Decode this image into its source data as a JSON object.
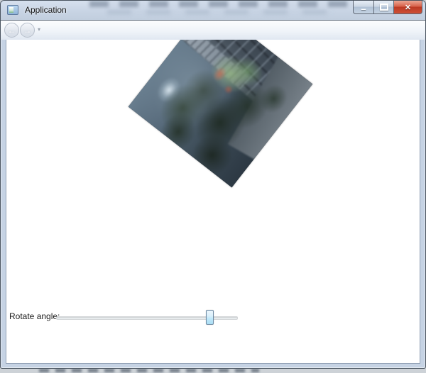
{
  "window": {
    "title": "Application",
    "controls": {
      "minimize_icon": "–",
      "maximize_icon": "maximize-box",
      "close_icon": "✕"
    }
  },
  "navbar": {
    "back_icon": "←",
    "forward_icon": "→",
    "dropdown_icon": "▾"
  },
  "content": {
    "image": {
      "name": "garden-courtyard-photo",
      "rotation_deg": 308
    },
    "slider": {
      "label": "Rotate angle:",
      "value_percent": 87
    }
  },
  "colors": {
    "close_button": "#ce5036",
    "glass_frame": "#c6d3e4",
    "slider_thumb": "#bfe7fa",
    "content_background": "#ffffff"
  }
}
